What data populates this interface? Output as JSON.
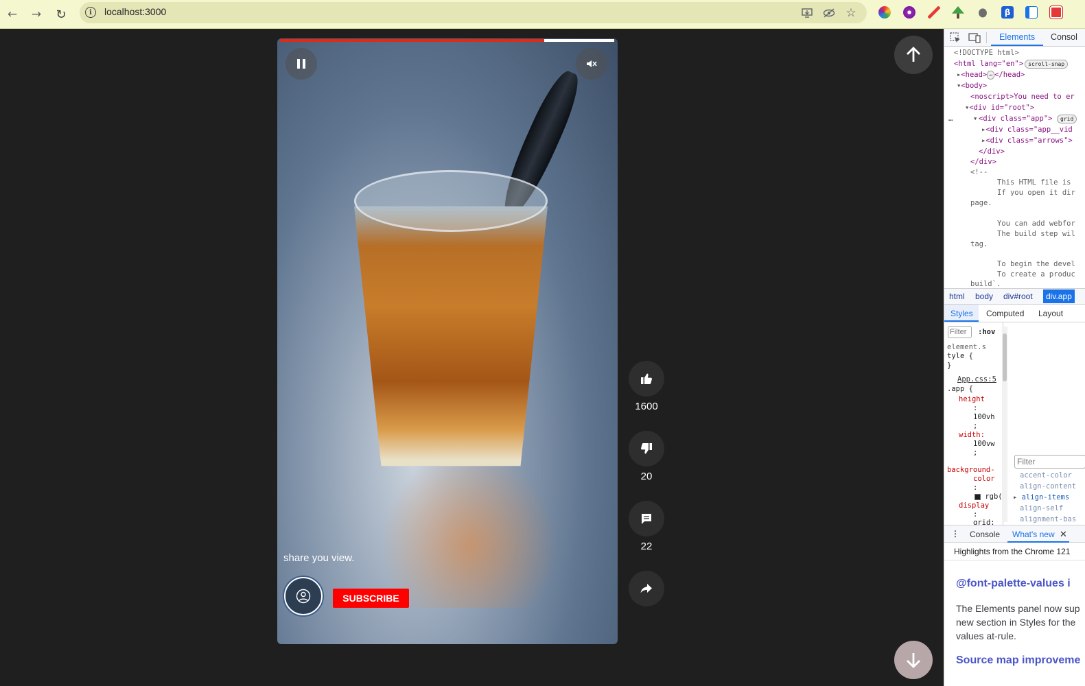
{
  "browser": {
    "url": "localhost:3000"
  },
  "video": {
    "progress": 0.79,
    "caption": "share you view.",
    "subscribe_label": "SUBSCRIBE"
  },
  "actions": {
    "likes": "1600",
    "dislikes": "20",
    "comments": "22"
  },
  "devtools": {
    "tabs": [
      "Elements",
      "Consol"
    ],
    "code_lines": [
      "<!DOCTYPE html>",
      "<html lang=\"en\">",
      "scroll-snap",
      "<head>",
      "</head>",
      "<body>",
      "<noscript>You need to er",
      "<div id=\"root\">",
      "<div class=\"app\">",
      "grid",
      "<div class=\"app__vid",
      "<div class=\"arrows\">",
      "</div>",
      "</div>",
      "<!--",
      "This HTML file is",
      "If you open it dir",
      "page.",
      "You can add webfor",
      "The build step wil",
      "tag.",
      "To begin the devel",
      "To create a produc",
      "build`."
    ],
    "breadcrumbs": [
      "html",
      "body",
      "div#root",
      "div.app"
    ],
    "sub_tabs": [
      "Styles",
      "Computed",
      "Layout"
    ],
    "styles": {
      "filter_placeholder": "Filter",
      "hov": ":hov",
      "element_style": "element.s",
      "element_style_2": "tyle {",
      "close_brace": "}",
      "source": "App.css:5",
      "selector": ".app {",
      "prop_height": "height",
      "val_height": "100vh",
      "prop_width": "width:",
      "val_width": "100vw",
      "prop_bg": "background-",
      "prop_bg_2": "color",
      "val_bg": "rgb(",
      "prop_display": "display",
      "val_display": "grid;",
      "colon": ":",
      "semicolon": ";"
    },
    "computed": {
      "filter_placeholder": "Filter",
      "props": [
        "accent-color",
        "align-content",
        "align-items",
        "align-self",
        "alignment-bas"
      ]
    },
    "drawer": {
      "tabs": [
        "Console",
        "What's new"
      ],
      "highlights": "Highlights from the Chrome 121",
      "heading1": "@font-palette-values i",
      "body_lines": [
        "The Elements panel now sup",
        "new section in Styles for the",
        "values at-rule."
      ],
      "heading2": "Source map improveme"
    }
  },
  "colors": {
    "accent_red": "#ff0000",
    "progress_red": "#e02916",
    "devtools_blue": "#1a73e8"
  }
}
